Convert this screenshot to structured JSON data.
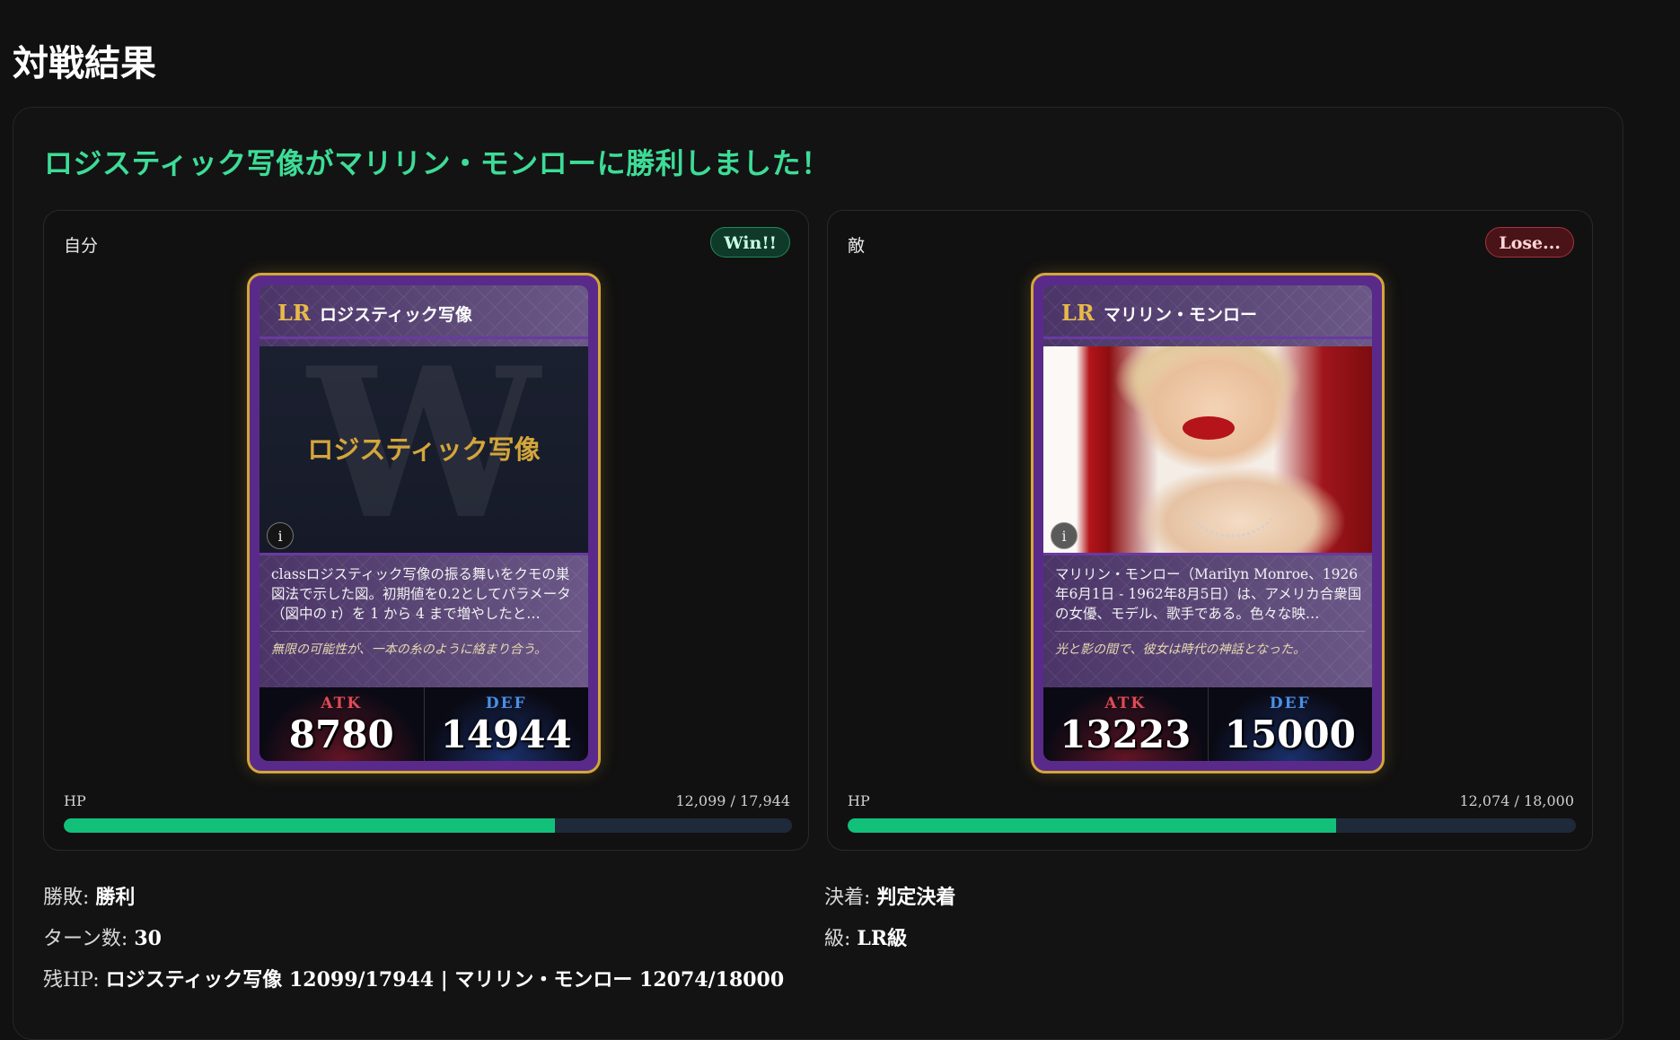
{
  "page": {
    "title": "対戦結果"
  },
  "result": {
    "headline": "ロジスティック写像がマリリン・モンローに勝利しました！"
  },
  "self": {
    "side_label": "自分",
    "badge": "Win!!",
    "card": {
      "rarity": "LR",
      "name": "ロジスティック写像",
      "art_watermark": "W",
      "art_title": "ロジスティック写像",
      "info_icon": "i",
      "description": "classロジスティック写像の振る舞いをクモの巣図法で示した図。初期値を0.2としてパラメータ（図中の r）を 1 から 4 まで増やしたと…",
      "flavor": "無限の可能性が、一本の糸のように絡まり合う。",
      "atk_label": "ATK",
      "atk": "8780",
      "def_label": "DEF",
      "def": "14944"
    },
    "hp_label": "HP",
    "hp_text": "12,099 / 17,944",
    "hp_fraction": 0.674
  },
  "enemy": {
    "side_label": "敵",
    "badge": "Lose...",
    "card": {
      "rarity": "LR",
      "name": "マリリン・モンロー",
      "info_icon": "i",
      "description": "マリリン・モンロー（Marilyn Monroe、1926年6月1日 - 1962年8月5日）は、アメリカ合衆国の女優、モデル、歌手である。色々な映…",
      "flavor": "光と影の間で、彼女は時代の神話となった。",
      "atk_label": "ATK",
      "atk": "13223",
      "def_label": "DEF",
      "def": "15000"
    },
    "hp_label": "HP",
    "hp_text": "12,074 / 18,000",
    "hp_fraction": 0.671
  },
  "summary": {
    "outcome_label": "勝敗: ",
    "outcome_value": "勝利",
    "decision_label": "決着: ",
    "decision_value": "判定決着",
    "turns_label": "ターン数: ",
    "turns_value": "30",
    "class_label": "級: ",
    "class_value": "LR級",
    "remaining_hp_label": "残HP: ",
    "remaining_hp_value": "ロジスティック写像 12099/17944 | マリリン・モンロー 12074/18000"
  },
  "colors": {
    "headline": "#3ddc97",
    "hp_fill": "#12c07a",
    "card_border": "#d4a63a",
    "card_frame": "#5a2a8a",
    "atk": "#e14a55",
    "def": "#4a8fe6"
  }
}
